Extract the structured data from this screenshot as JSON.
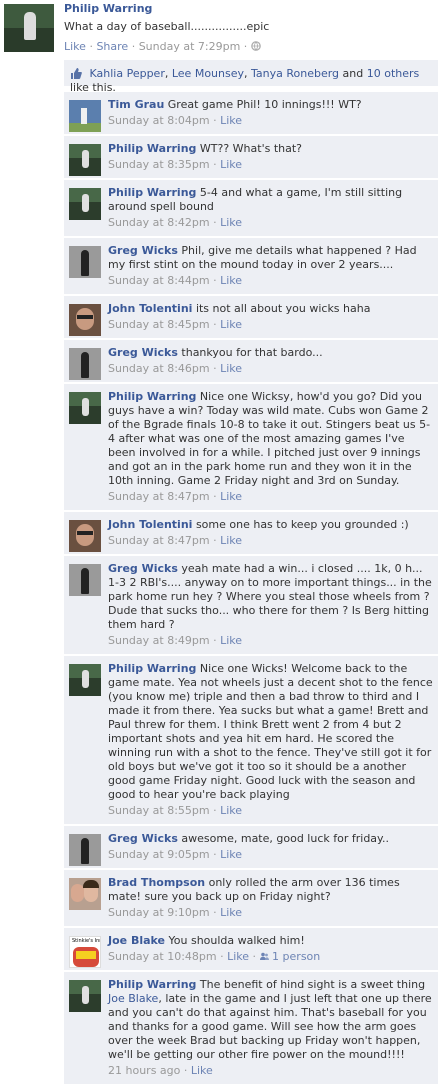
{
  "post": {
    "author": "Philip Warring",
    "text": "What a day of baseball................epic",
    "like_label": "Like",
    "share_label": "Share",
    "time": "Sunday at 7:29pm",
    "separator": "·"
  },
  "likes": {
    "names": [
      "Kahlia Pepper",
      "Lee Mounsey",
      "Tanya Roneberg"
    ],
    "sep1": ", ",
    "sep2": ", ",
    "and_text": " and ",
    "others": "10 others",
    "suffix": " like this."
  },
  "comment_like_label": "Like",
  "comments": [
    {
      "author": "Tim Grau",
      "text": "Great game Phil! 10 innings!!! WT?",
      "time": "Sunday at 8:04pm"
    },
    {
      "author": "Philip Warring",
      "text": "WT?? What's that?",
      "time": "Sunday at 8:35pm"
    },
    {
      "author": "Philip Warring",
      "text": "5-4 and what a game, I'm still sitting around spell bound",
      "time": "Sunday at 8:42pm"
    },
    {
      "author": "Greg Wicks",
      "text": "Phil, give me details what happened ? Had my first stint on the mound today in over 2 years....",
      "time": "Sunday at 8:44pm"
    },
    {
      "author": "John Tolentini",
      "text": "its not all about you wicks haha",
      "time": "Sunday at 8:45pm"
    },
    {
      "author": "Greg Wicks",
      "text": "thankyou for that bardo...",
      "time": "Sunday at 8:46pm"
    },
    {
      "author": "Philip Warring",
      "text": "Nice one Wicksy, how'd you go? Did you guys have a win? Today was wild mate. Cubs won Game 2 of the Bgrade finals 10-8 to take it out. Stingers beat us 5-4 after what was one of the most amazing games I've been involved in for a while. I pitched just over 9 innings and got an in the park home run and they won it in the 10th inning. Game 2 Friday night and 3rd on Sunday.",
      "time": "Sunday at 8:47pm"
    },
    {
      "author": "John Tolentini",
      "text": "some one has to keep you grounded :)",
      "time": "Sunday at 8:47pm"
    },
    {
      "author": "Greg Wicks",
      "text": "yeah mate had a win... i closed .... 1k, 0 h... 1-3 2 RBI's.... anyway on to more important things... in the park home run hey ? Where you steal those wheels from ? Dude that sucks tho... who there for them ? Is Berg hitting them hard ?",
      "time": "Sunday at 8:49pm"
    },
    {
      "author": "Philip Warring",
      "text": "Nice one Wicks! Welcome back to the game mate. Yea not wheels just a decent shot to the fence (you know me) triple and then a bad throw to third and I made it from there. Yea sucks but what a game! Brett and Paul threw for them. I think Brett went 2 from 4 but 2 important shots and yea hit em hard. He scored the winning run with a shot to the fence. They've still got it for old boys but we've got it too so it should be a another good game Friday night. Good luck with the season and good to hear you're back playing",
      "time": "Sunday at 8:55pm"
    },
    {
      "author": "Greg Wicks",
      "text": "awesome, mate, good luck for friday..",
      "time": "Sunday at 9:05pm"
    },
    {
      "author": "Brad Thompson",
      "text": "only rolled the arm over 136 times mate! sure you back up on Friday night?",
      "time": "Sunday at 9:10pm"
    },
    {
      "author": "Joe Blake",
      "text": "You shoulda walked him!",
      "time": "Sunday at 10:48pm",
      "like_count": "1 person"
    },
    {
      "author": "Philip Warring",
      "text_before": "The benefit of hind sight is a sweet thing ",
      "mention": "Joe Blake",
      "text_after": ", late in the game and I just left that one up there and you can't do that against him. That's baseball for you and thanks for a good game. Will see how the arm goes over the week Brad but backing up Friday won't happen, we'll be getting our other fire power on the mound!!!!",
      "time": "21 hours ago"
    }
  ],
  "icons": {
    "post_avatar": "pitcher-photo",
    "thumb": "thumbs-up-icon",
    "globe": "globe-icon",
    "people": "people-icon"
  },
  "joe_avatar_text": "Stinkie's Inn"
}
